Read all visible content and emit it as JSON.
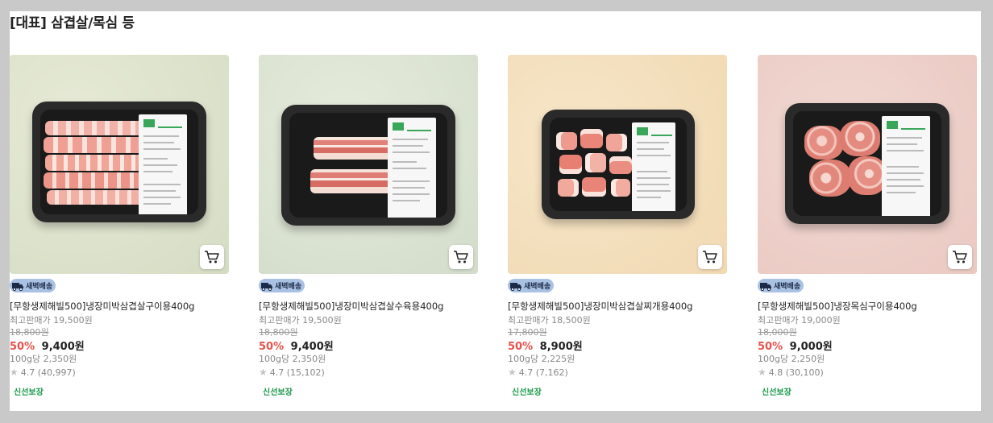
{
  "section": {
    "title": "[대표] 삼겹살/목심 등"
  },
  "colors": {
    "discount": "#e8524a",
    "fresh": "#1a9a4a",
    "badge_bg": "#a9c1e3"
  },
  "products": [
    {
      "badge": "새벽배송",
      "name": "[무항생제해빌500]냉장미박삼겹살구이용400g",
      "max_price": "최고판매가 19,500원",
      "original_price": "18,800원",
      "discount": "50%",
      "sale_price": "9,400원",
      "unit_price": "100g당 2,350원",
      "rating": "4.7 (40,997)",
      "tag": "신선보장",
      "icon": "cart-icon"
    },
    {
      "badge": "새벽배송",
      "name": "[무항생제해빌500]냉장미박삼겹살수육용400g",
      "max_price": "최고판매가 19,500원",
      "original_price": "18,800원",
      "discount": "50%",
      "sale_price": "9,400원",
      "unit_price": "100g당 2,350원",
      "rating": "4.7 (15,102)",
      "tag": "신선보장",
      "icon": "cart-icon"
    },
    {
      "badge": "새벽배송",
      "name": "[무항생제해빌500]냉장미박삼겹살찌개용400g",
      "max_price": "최고판매가 18,500원",
      "original_price": "17,800원",
      "discount": "50%",
      "sale_price": "8,900원",
      "unit_price": "100g당 2,225원",
      "rating": "4.7 (7,162)",
      "tag": "신선보장",
      "icon": "cart-icon"
    },
    {
      "badge": "새벽배송",
      "name": "[무항생제해빌500]냉장목심구이용400g",
      "max_price": "최고판매가 19,000원",
      "original_price": "18,000원",
      "discount": "50%",
      "sale_price": "9,000원",
      "unit_price": "100g당 2,250원",
      "rating": "4.8 (30,100)",
      "tag": "신선보장",
      "icon": "cart-icon"
    }
  ]
}
